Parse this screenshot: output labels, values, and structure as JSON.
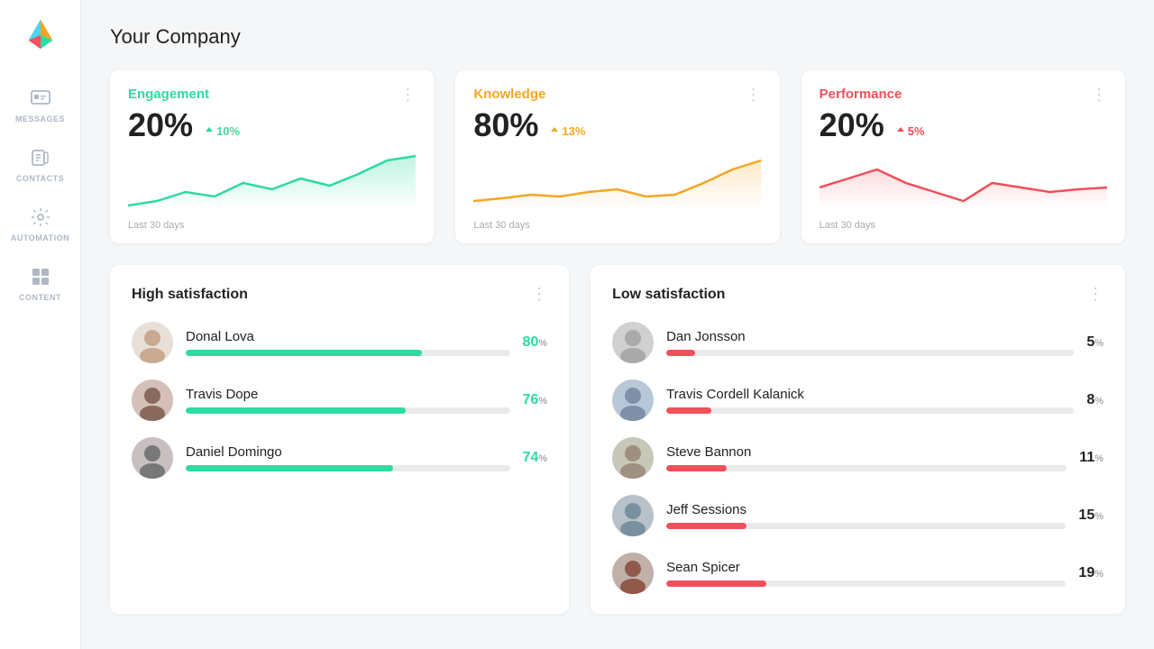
{
  "page": {
    "title": "Your Company"
  },
  "sidebar": {
    "items": [
      {
        "id": "messages",
        "label": "MESSAGES"
      },
      {
        "id": "contacts",
        "label": "CONTACTS"
      },
      {
        "id": "automation",
        "label": "AUTOMATION"
      },
      {
        "id": "content",
        "label": "CONTENT"
      }
    ]
  },
  "metrics": [
    {
      "id": "engagement",
      "title": "Engagement",
      "titleColor": "#2edba0",
      "value": "20%",
      "change": "10%",
      "changeDirection": "up",
      "footer": "Last 30 days",
      "chartColor": "#2edba0",
      "chartFill": "rgba(46,219,160,0.15)",
      "chartPoints": "0,60 30,55 60,45 90,50 120,35 150,42 180,30 210,38 240,25 270,10 300,5"
    },
    {
      "id": "knowledge",
      "title": "Knowledge",
      "titleColor": "#f5a623",
      "value": "80%",
      "change": "13%",
      "changeDirection": "up",
      "footer": "Last 30 days",
      "chartColor": "#f5a623",
      "chartFill": "rgba(245,166,35,0.12)",
      "chartPoints": "0,55 30,52 60,48 90,50 120,45 150,42 180,50 210,48 240,35 270,20 300,10"
    },
    {
      "id": "performance",
      "title": "Performance",
      "titleColor": "#f0505a",
      "value": "20%",
      "change": "5%",
      "changeDirection": "up",
      "footer": "Last 30 days",
      "chartColor": "#f0505a",
      "chartFill": "rgba(240,80,90,0.10)",
      "chartPoints": "0,40 30,30 60,20 90,35 120,45 150,55 180,35 210,40 240,45 270,42 300,40"
    }
  ],
  "high_satisfaction": {
    "title": "High satisfaction",
    "persons": [
      {
        "name": "Donal Lova",
        "pct": 80,
        "barWidth": "73%"
      },
      {
        "name": "Travis Dope",
        "pct": 76,
        "barWidth": "68%"
      },
      {
        "name": "Daniel Domingo",
        "pct": 74,
        "barWidth": "64%"
      }
    ]
  },
  "low_satisfaction": {
    "title": "Low satisfaction",
    "persons": [
      {
        "name": "Dan Jonsson",
        "pct": 5,
        "barWidth": "7%"
      },
      {
        "name": "Travis Cordell Kalanick",
        "pct": 8,
        "barWidth": "11%"
      },
      {
        "name": "Steve Bannon",
        "pct": 11,
        "barWidth": "15%"
      },
      {
        "name": "Jeff Sessions",
        "pct": 15,
        "barWidth": "20%"
      },
      {
        "name": "Sean Spicer",
        "pct": 19,
        "barWidth": "25%"
      }
    ]
  },
  "labels": {
    "last30": "Last 30 days",
    "menu": "⋮"
  }
}
